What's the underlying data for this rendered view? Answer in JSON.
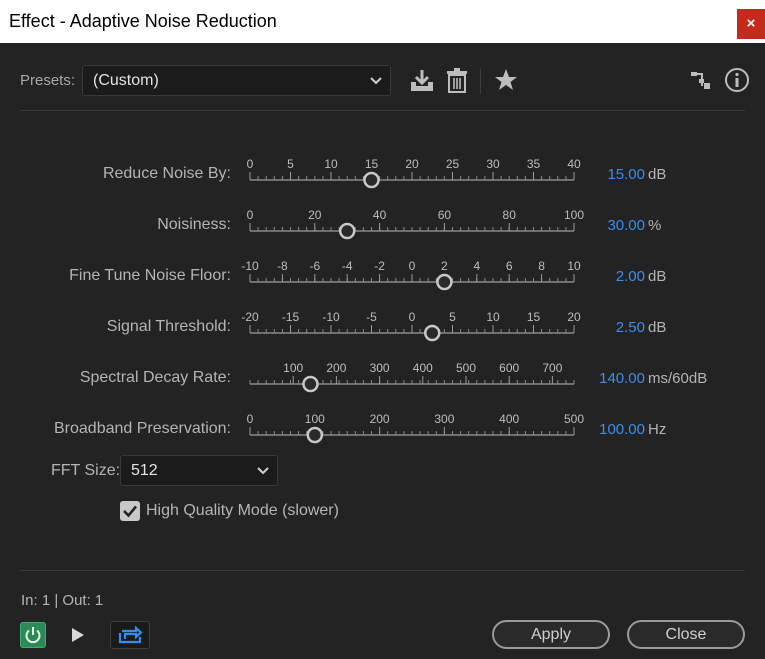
{
  "window": {
    "title": "Effect - Adaptive Noise Reduction",
    "close_glyph": "×"
  },
  "presets": {
    "label": "Presets:",
    "selected": "(Custom)",
    "icons": [
      "save-preset-icon",
      "delete-preset-icon",
      "favorite-star-icon",
      "routing-icon",
      "info-icon"
    ]
  },
  "params": [
    {
      "label": "Reduce Noise By:",
      "value": "15.00",
      "unit": "dB",
      "ticks": [
        "0",
        "5",
        "10",
        "15",
        "20",
        "25",
        "30",
        "35",
        "40"
      ],
      "min": 0,
      "max": 40,
      "current": 15
    },
    {
      "label": "Noisiness:",
      "value": "30.00",
      "unit": "%",
      "ticks": [
        "0",
        "20",
        "40",
        "60",
        "80",
        "100"
      ],
      "min": 0,
      "max": 100,
      "current": 30
    },
    {
      "label": "Fine Tune Noise Floor:",
      "value": "2.00",
      "unit": "dB",
      "ticks": [
        "-10",
        "-8",
        "-6",
        "-4",
        "-2",
        "0",
        "2",
        "4",
        "6",
        "8",
        "10"
      ],
      "min": -10,
      "max": 10,
      "current": 2
    },
    {
      "label": "Signal Threshold:",
      "value": "2.50",
      "unit": "dB",
      "ticks": [
        "-20",
        "-15",
        "-10",
        "-5",
        "0",
        "5",
        "10",
        "15",
        "20"
      ],
      "min": -20,
      "max": 20,
      "current": 2.5
    },
    {
      "label": "Spectral Decay Rate:",
      "value": "140.00",
      "unit": "ms/60dB",
      "ticks": [
        "100",
        "200",
        "300",
        "400",
        "500",
        "600",
        "700"
      ],
      "min": 0,
      "max": 750,
      "current": 140
    },
    {
      "label": "Broadband Preservation:",
      "value": "100.00",
      "unit": "Hz",
      "ticks": [
        "0",
        "100",
        "200",
        "300",
        "400",
        "500"
      ],
      "min": 0,
      "max": 500,
      "current": 100
    }
  ],
  "fft": {
    "label": "FFT Size:",
    "selected": "512"
  },
  "high_quality": {
    "label": "High Quality Mode (slower)",
    "checked": true
  },
  "footer": {
    "io_text": "In: 1 | Out: 1",
    "apply_label": "Apply",
    "close_label": "Close"
  },
  "colors": {
    "accent_value": "#3b8eed",
    "power_on": "#2b8a56",
    "loop_icon": "#2f8ff0"
  }
}
